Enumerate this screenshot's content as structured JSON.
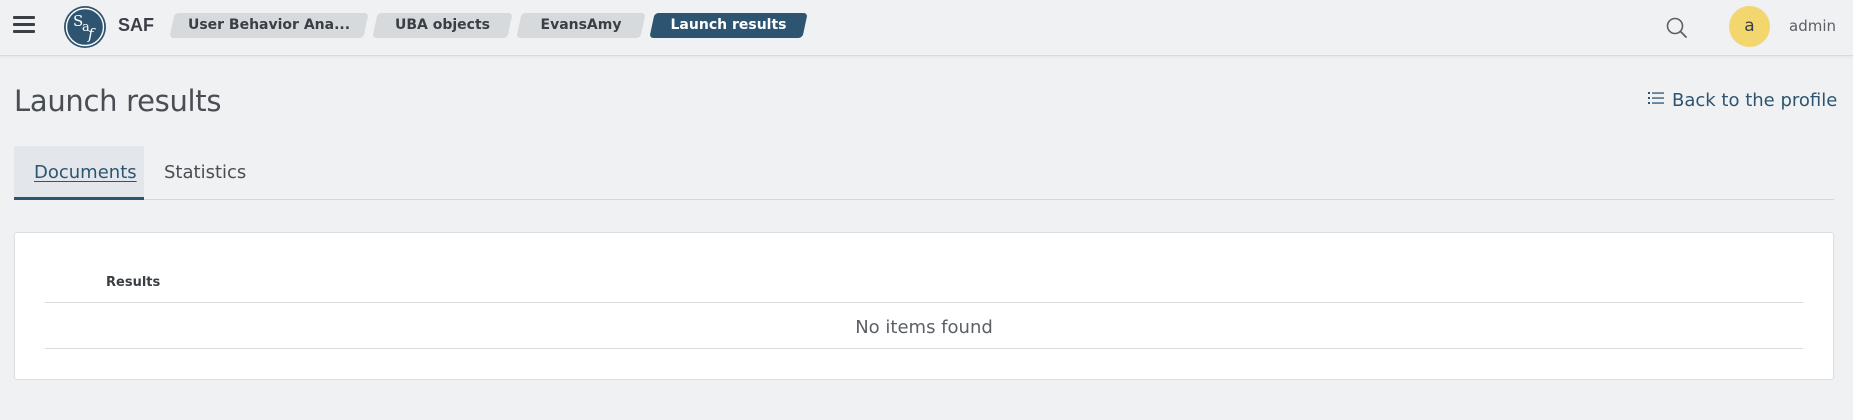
{
  "app": {
    "name": "SAF",
    "logo_text": "Saf"
  },
  "breadcrumbs": [
    {
      "label": "User Behavior Ana..."
    },
    {
      "label": "UBA objects"
    },
    {
      "label": "EvansAmy"
    },
    {
      "label": "Launch results"
    }
  ],
  "user": {
    "avatar_letter": "a",
    "name": "admin"
  },
  "page": {
    "title": "Launch results",
    "back_label": "Back to the profile"
  },
  "tabs": [
    {
      "label": "Documents",
      "active": true
    },
    {
      "label": "Statistics",
      "active": false
    }
  ],
  "table": {
    "columns": [
      "Results"
    ],
    "empty_message": "No items found"
  },
  "colors": {
    "accent": "#2d5470",
    "avatar": "#f3d66e",
    "crumb_inactive": "#d7dadd",
    "background": "#f0f1f2"
  },
  "icons": {
    "menu": "hamburger-icon",
    "search": "search-icon",
    "back": "list-icon"
  }
}
